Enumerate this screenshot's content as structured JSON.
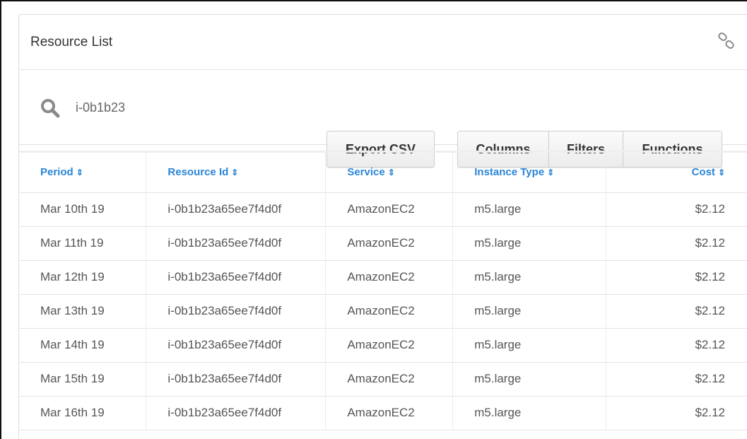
{
  "panel": {
    "title": "Resource List"
  },
  "search": {
    "value": "i-0b1b23"
  },
  "toolbar": {
    "export_label": "Export CSV",
    "columns_label": "Columns",
    "filters_label": "Filters",
    "functions_label": "Functions"
  },
  "table": {
    "sort_glyph": "⇕",
    "headers": {
      "period": "Period",
      "resource_id": "Resource Id",
      "service": "Service",
      "instance_type": "Instance Type",
      "cost": "Cost"
    },
    "rows": [
      {
        "period": "Mar 10th 19",
        "resource_id": "i-0b1b23a65ee7f4d0f",
        "service": "AmazonEC2",
        "instance_type": "m5.large",
        "cost": "$2.12"
      },
      {
        "period": "Mar 11th 19",
        "resource_id": "i-0b1b23a65ee7f4d0f",
        "service": "AmazonEC2",
        "instance_type": "m5.large",
        "cost": "$2.12"
      },
      {
        "period": "Mar 12th 19",
        "resource_id": "i-0b1b23a65ee7f4d0f",
        "service": "AmazonEC2",
        "instance_type": "m5.large",
        "cost": "$2.12"
      },
      {
        "period": "Mar 13th 19",
        "resource_id": "i-0b1b23a65ee7f4d0f",
        "service": "AmazonEC2",
        "instance_type": "m5.large",
        "cost": "$2.12"
      },
      {
        "period": "Mar 14th 19",
        "resource_id": "i-0b1b23a65ee7f4d0f",
        "service": "AmazonEC2",
        "instance_type": "m5.large",
        "cost": "$2.12"
      },
      {
        "period": "Mar 15th 19",
        "resource_id": "i-0b1b23a65ee7f4d0f",
        "service": "AmazonEC2",
        "instance_type": "m5.large",
        "cost": "$2.12"
      },
      {
        "period": "Mar 16th 19",
        "resource_id": "i-0b1b23a65ee7f4d0f",
        "service": "AmazonEC2",
        "instance_type": "m5.large",
        "cost": "$2.12"
      }
    ]
  },
  "colors": {
    "header_link": "#2a86d6",
    "icon_gray": "#8a8a8a"
  },
  "icons": {
    "search": "search-icon",
    "link": "link-icon"
  }
}
